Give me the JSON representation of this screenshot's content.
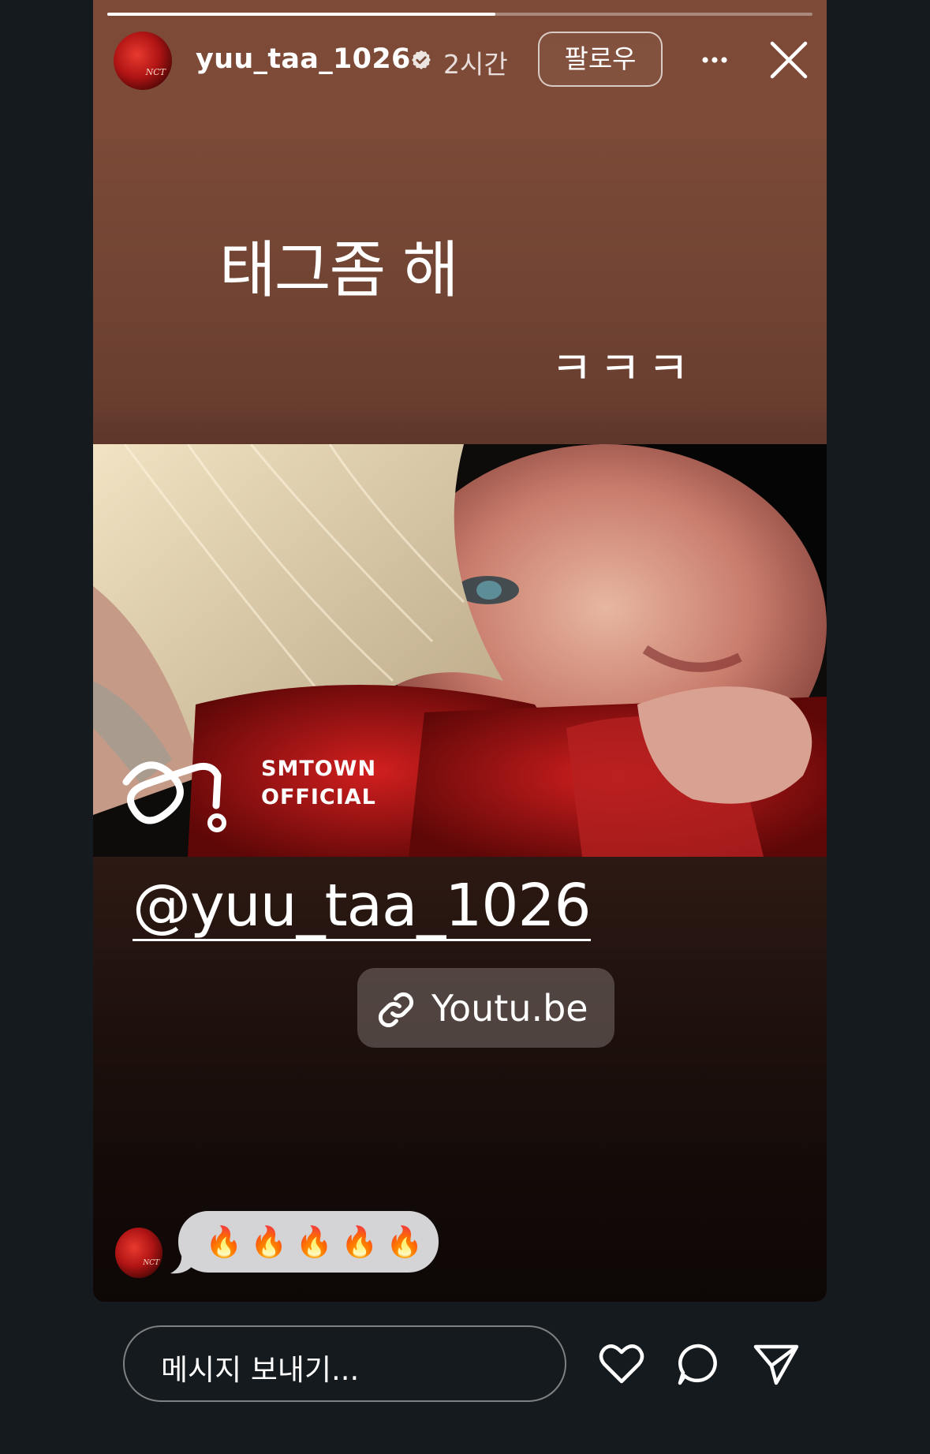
{
  "story": {
    "progress": 0.55,
    "header": {
      "username": "yuu_taa_1026",
      "time": "2시간",
      "follow_label": "팔로우"
    },
    "caption_main": "태그좀 해",
    "caption_laugh": "ㅋㅋㅋ",
    "photo": {
      "brand_line1": "SMTOWN",
      "brand_line2": "OFFICIAL"
    },
    "mention": "@yuu_taa_1026",
    "link_label": "Youtu.be",
    "reply": {
      "emojis": "🔥🔥🔥🔥🔥"
    }
  },
  "bottom_bar": {
    "message_placeholder": "메시지 보내기..."
  },
  "colors": {
    "story_top": "#7c4a36",
    "story_bottom": "#0d0706",
    "page_background": "#151a1e",
    "bubble": "#d4d4d6"
  },
  "icons": [
    "verified-badge-icon",
    "more-icon",
    "close-icon",
    "link-icon",
    "heart-icon",
    "comment-icon",
    "send-icon"
  ]
}
